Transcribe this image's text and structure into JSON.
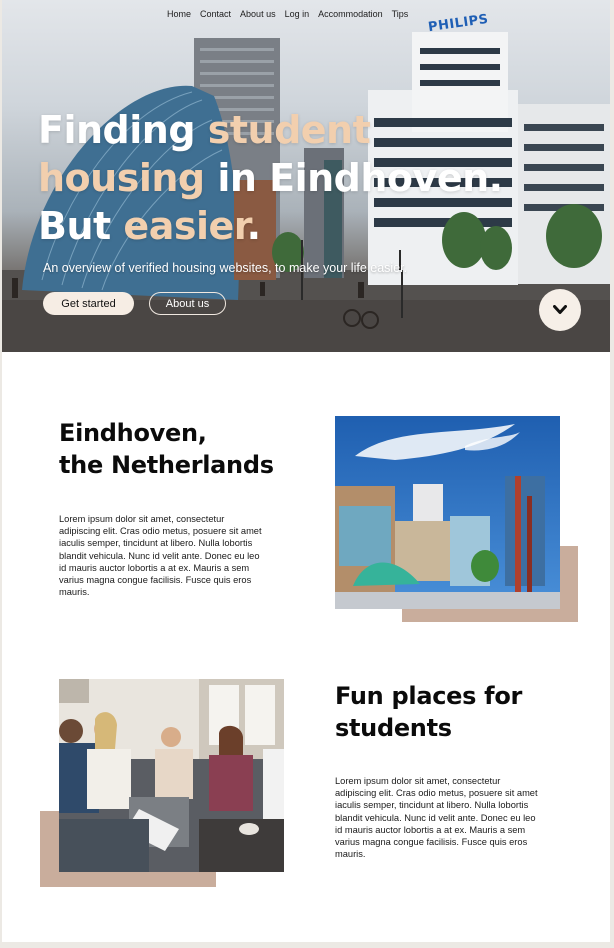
{
  "nav": {
    "items": [
      "Home",
      "Contact",
      "About us",
      "Log in",
      "Accommodation",
      "Tips"
    ]
  },
  "hero": {
    "headline": {
      "line1_a": "Finding ",
      "line1_b": "student",
      "line2_a": "housing",
      "line2_b": " in Eindhoven.",
      "line3_a": "But ",
      "line3_b": "easier",
      "line3_c": "."
    },
    "subtitle": "An overview of verified housing websites, to make your life easier.",
    "primary_button": "Get started",
    "secondary_button": "About us",
    "building_sign": "PHILIPS",
    "scroll_icon": "chevron-down-icon"
  },
  "section1": {
    "title_line1": "Eindhoven,",
    "title_line2": "the Netherlands",
    "body": "Lorem ipsum dolor sit amet, consectetur adipiscing elit. Cras odio metus, posuere sit amet iaculis semper, tincidunt at libero. Nulla lobortis blandit vehicula. Nunc id velit ante. Donec eu leo id mauris auctor lobortis a at ex. Mauris a sem varius magna congue facilisis. Fusce quis eros mauris."
  },
  "section2": {
    "title_line1": "Fun places for",
    "title_line2": "students",
    "body": "Lorem ipsum dolor sit amet, consectetur adipiscing elit. Cras odio metus, posuere sit amet iaculis semper, tincidunt at libero. Nulla lobortis blandit vehicula. Nunc id velit ante. Donec eu leo id mauris auctor lobortis a at ex. Mauris a sem varius magna congue facilisis. Fusce quis eros mauris."
  },
  "colors": {
    "accent": "#f2cfae",
    "shadow_block": "#c9ad9c",
    "button_bg": "#f6ede4"
  }
}
